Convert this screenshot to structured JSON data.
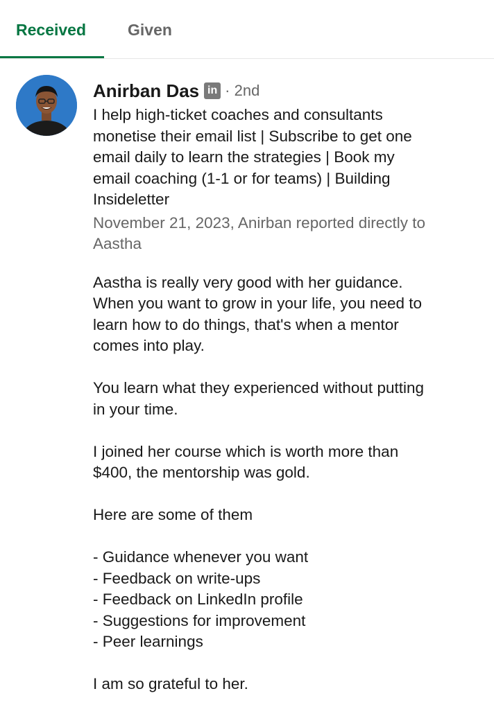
{
  "tabs": {
    "received": "Received",
    "given": "Given"
  },
  "recommendation": {
    "name": "Anirban Das",
    "linkedin_badge": "in",
    "degree": "· 2nd",
    "headline_lines": [
      "I help high-ticket coaches and consultants",
      "monetise their email list | Subscribe to get one",
      "email daily to learn the strategies | Book my",
      "email coaching (1-1 or for teams) | Building",
      "Insideletter"
    ],
    "relation_lines": [
      "November 21, 2023, Anirban reported directly to",
      "Aastha"
    ],
    "paragraph1_lines": [
      "Aastha is really very good with her guidance.",
      "When you want to grow in your life, you need to",
      "learn how to do things, that's when a mentor",
      "comes into play."
    ],
    "paragraph2_lines": [
      "You learn what they experienced without putting",
      "in your time."
    ],
    "paragraph3_lines": [
      "I joined her course which is worth more than",
      "$400, the mentorship was gold."
    ],
    "paragraph4": "Here are some of them",
    "list_items": [
      "- Guidance whenever you want",
      "- Feedback on write-ups",
      "- Feedback on LinkedIn profile",
      "- Suggestions for improvement",
      "- Peer learnings"
    ],
    "closing": "I am so grateful to her."
  },
  "colors": {
    "accent_green": "#057642",
    "secondary_text": "#666666",
    "primary_text": "#191919"
  }
}
